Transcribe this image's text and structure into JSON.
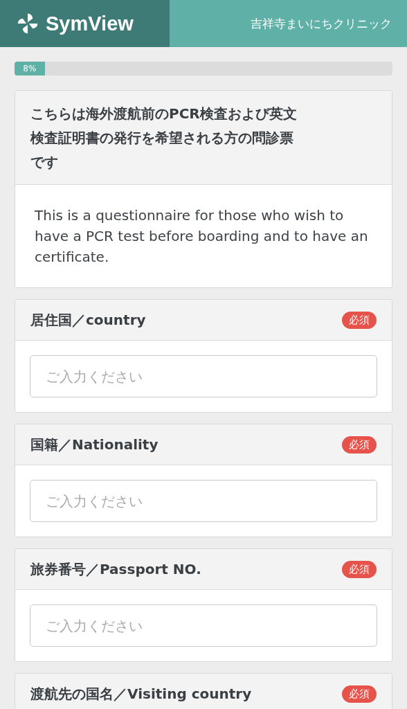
{
  "header": {
    "logo_text": "SymView",
    "clinic_name": "吉祥寺まいにちクリニック"
  },
  "progress": {
    "label": "8%",
    "level": 0.08
  },
  "intro": {
    "title": "こちらは海外渡航前のPCR検査および英文検査証明書の発行を希望される方の問診票です",
    "description": "This is a questionnaire for those who wish to have a PCR test before boarding and to have an certificate."
  },
  "questions": [
    {
      "label": "居住国／country",
      "required": true,
      "required_label": "必須",
      "placeholder": "ご入力ください"
    },
    {
      "label": "国籍／Nationality",
      "required": true,
      "required_label": "必須",
      "placeholder": "ご入力ください"
    },
    {
      "label": "旅券番号／Passport NO.",
      "required": true,
      "required_label": "必須",
      "placeholder": "ご入力ください"
    },
    {
      "label": "渡航先の国名／Visiting country",
      "required": true,
      "required_label": "必須"
    }
  ]
}
